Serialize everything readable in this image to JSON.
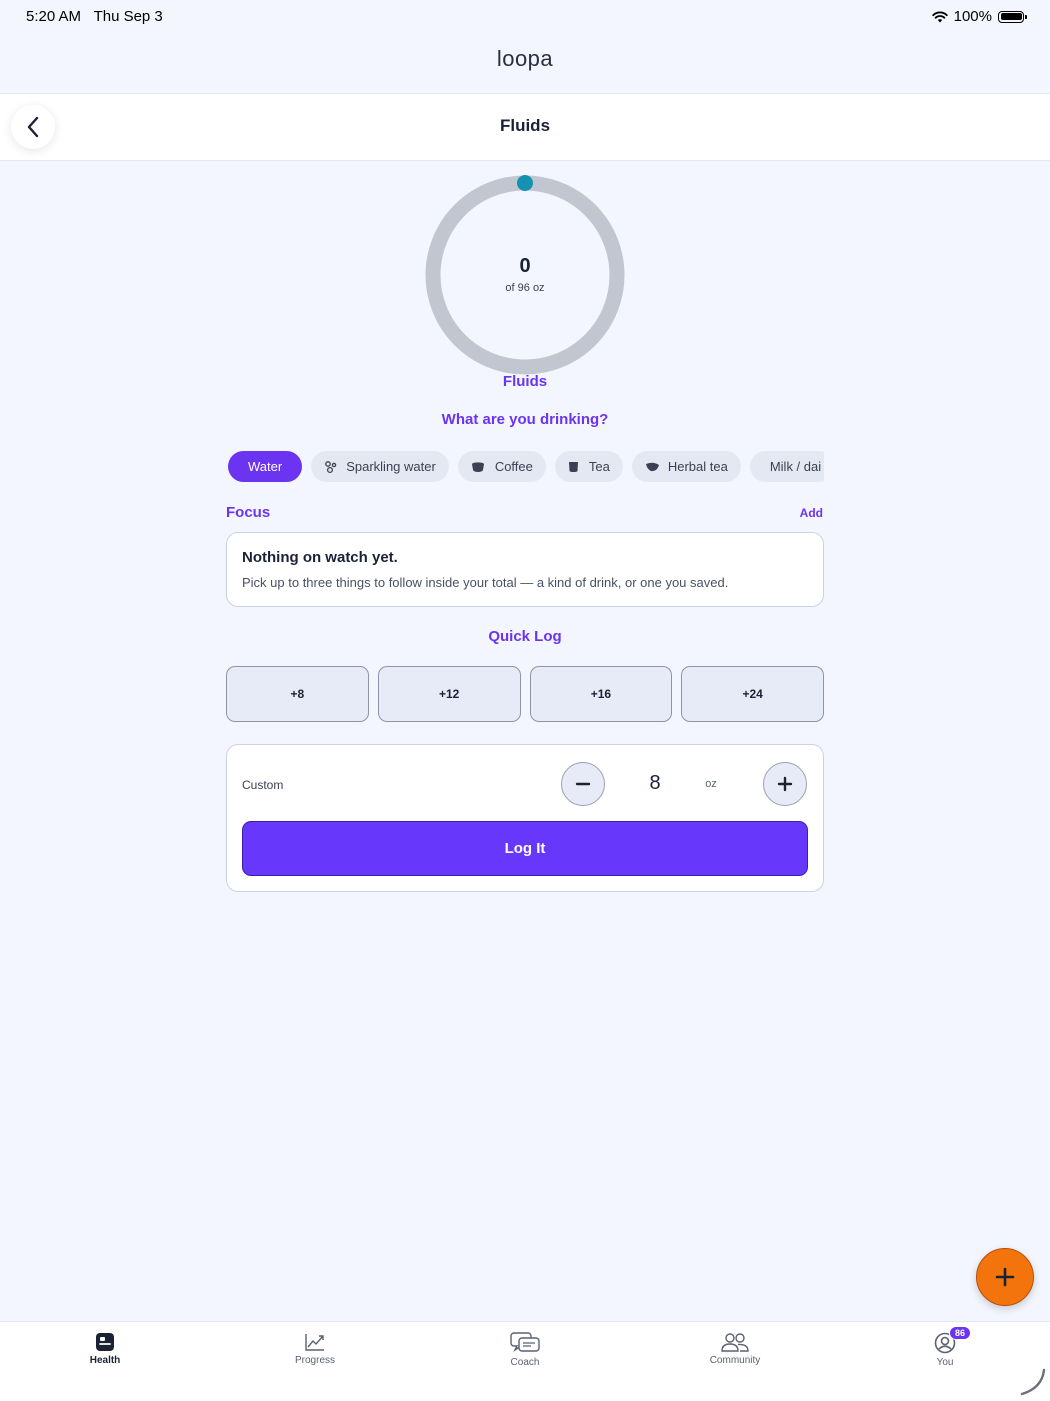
{
  "status_bar": {
    "time": "5:20 AM",
    "date": "Thu Sep 3",
    "battery": "100%"
  },
  "app": {
    "logo": "loopa"
  },
  "header": {
    "title": "Fluids",
    "back_icon": "chevron-left-icon"
  },
  "ring": {
    "value": "0",
    "subtitle": "of 96 oz",
    "label": "Fluids",
    "progress": 0,
    "track_color": "#c1c6d0",
    "dot_color": "#1591b2"
  },
  "drink_prompt": "What are you drinking?",
  "chips": [
    {
      "label": "Water",
      "icon": "",
      "active": true
    },
    {
      "label": "Sparkling water",
      "icon": "bubbles-icon",
      "active": false
    },
    {
      "label": "Coffee",
      "icon": "coffee-icon",
      "active": false
    },
    {
      "label": "Tea",
      "icon": "mug-icon",
      "active": false
    },
    {
      "label": "Herbal tea",
      "icon": "leaf-icon",
      "active": false
    },
    {
      "label": "Milk / dai",
      "icon": "",
      "active": false
    }
  ],
  "focus": {
    "title": "Focus",
    "add_label": "Add",
    "empty_title": "Nothing on watch yet.",
    "empty_body": "Pick up to three things to follow inside your total — a kind of drink, or one you saved."
  },
  "quick_log": {
    "title": "Quick Log",
    "buttons": [
      "+8",
      "+12",
      "+16",
      "+24"
    ]
  },
  "custom": {
    "label": "Custom",
    "value": "8",
    "unit": "oz",
    "submit": "Log It"
  },
  "fab_icon": "plus-icon",
  "colors": {
    "accent": "#6b34f0",
    "fab": "#f3740c",
    "background": "#f3f6fe"
  },
  "tabbar": {
    "items": [
      {
        "label": "Health",
        "icon": "health-icon",
        "active": true
      },
      {
        "label": "Progress",
        "icon": "chart-icon",
        "active": false
      },
      {
        "label": "Coach",
        "icon": "chat-icon",
        "active": false
      },
      {
        "label": "Community",
        "icon": "people-icon",
        "active": false
      },
      {
        "label": "You",
        "icon": "profile-icon",
        "active": false,
        "badge": "86"
      }
    ]
  }
}
